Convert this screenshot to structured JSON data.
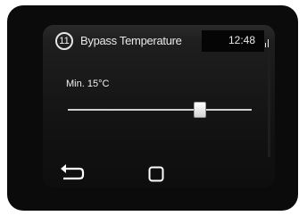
{
  "header": {
    "badge_number": "11",
    "title": "Bypass Temperature",
    "time": "12:48"
  },
  "setting": {
    "label": "Min. 15°C",
    "slider_level": 0.72
  },
  "icons": {
    "back": "back-arrow-icon",
    "home": "square-home-icon",
    "status": "signal-icon"
  },
  "colors": {
    "screen_bg": "#121212",
    "text": "#f0f0f0",
    "track": "#cfcfcf"
  }
}
